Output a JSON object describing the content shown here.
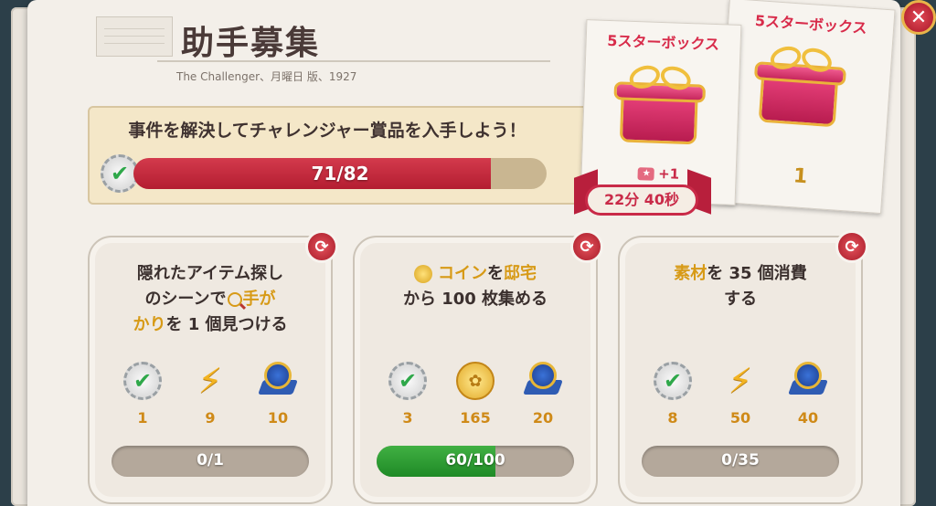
{
  "header": {
    "title": "助手募集",
    "subtitle": "The Challenger、月曜日 版、1927"
  },
  "goal": {
    "text": "事件を解決してチャレンジャー賞品を入手しよう！",
    "progress_text": "71/82",
    "progress_value": 71,
    "progress_max": 82
  },
  "prizes": {
    "front": {
      "label": "5スターボックス",
      "bonus": "+1",
      "timer": "22分 40秒"
    },
    "back": {
      "label": "5スターボックス",
      "count": "1"
    }
  },
  "tasks": [
    {
      "text_a": "隠れたアイテム探し",
      "text_b": "のシーンで",
      "text_c": "手が",
      "text_d": "かり",
      "text_e": "を 1 個見つける",
      "rewards": [
        "1",
        "9",
        "10"
      ],
      "progress_text": "0/1",
      "progress_value": 0,
      "progress_max": 1
    },
    {
      "text_a": "コイン",
      "text_b": "を",
      "text_c": "邸宅",
      "text_d": "から 100 枚集める",
      "rewards": [
        "3",
        "165",
        "20"
      ],
      "progress_text": "60/100",
      "progress_value": 60,
      "progress_max": 100
    },
    {
      "text_a": "素材",
      "text_b": "を 35 個消費",
      "text_c": "する",
      "rewards": [
        "8",
        "50",
        "40"
      ],
      "progress_text": "0/35",
      "progress_value": 0,
      "progress_max": 35
    }
  ],
  "icons": {
    "check": "check-badge-icon",
    "bolt": "lightning-icon",
    "medal": "magnifier-medal-icon",
    "coin": "coin-icon",
    "refresh": "refresh-icon",
    "close": "close-icon"
  },
  "colors": {
    "goal_bar": "#c8283f",
    "task_bar": "#2f9a33",
    "accent_gold": "#d79a16",
    "accent_red": "#c92a48"
  }
}
